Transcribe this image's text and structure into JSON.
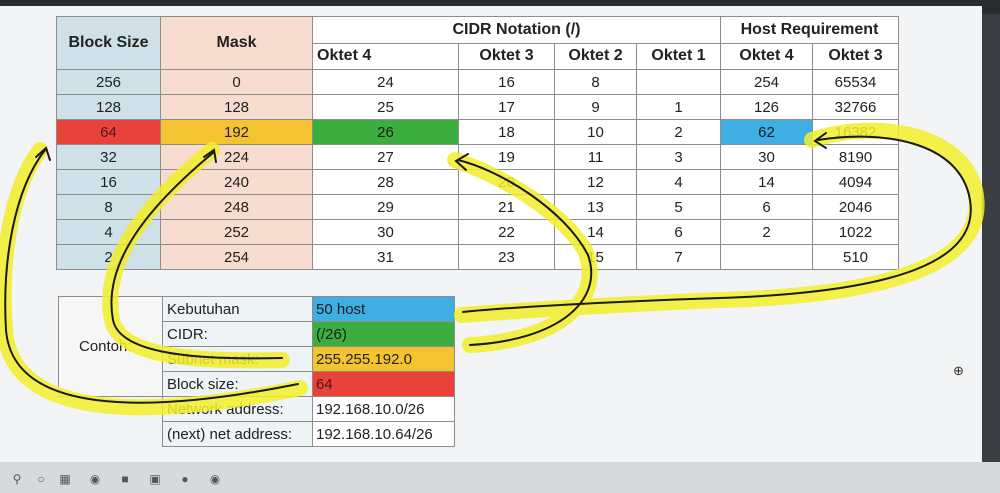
{
  "main_table": {
    "headers": {
      "block_size": "Block Size",
      "mask": "Mask",
      "cidr_group": "CIDR Notation (/)",
      "host_group": "Host Requirement",
      "oktet4": "Oktet 4",
      "oktet3": "Oktet 3",
      "oktet2": "Oktet 2",
      "oktet1": "Oktet 1",
      "host_oktet4": "Oktet 4",
      "host_oktet3": "Oktet 3"
    },
    "rows": [
      {
        "block": "256",
        "mask": "0",
        "c4": "24",
        "c3": "16",
        "c2": "8",
        "c1": "",
        "h4": "254",
        "h3": "65534"
      },
      {
        "block": "128",
        "mask": "128",
        "c4": "25",
        "c3": "17",
        "c2": "9",
        "c1": "1",
        "h4": "126",
        "h3": "32766"
      },
      {
        "block": "64",
        "mask": "192",
        "c4": "26",
        "c3": "18",
        "c2": "10",
        "c1": "2",
        "h4": "62",
        "h3": "16382"
      },
      {
        "block": "32",
        "mask": "224",
        "c4": "27",
        "c3": "19",
        "c2": "11",
        "c1": "3",
        "h4": "30",
        "h3": "8190"
      },
      {
        "block": "16",
        "mask": "240",
        "c4": "28",
        "c3": "20",
        "c2": "12",
        "c1": "4",
        "h4": "14",
        "h3": "4094"
      },
      {
        "block": "8",
        "mask": "248",
        "c4": "29",
        "c3": "21",
        "c2": "13",
        "c1": "5",
        "h4": "6",
        "h3": "2046"
      },
      {
        "block": "4",
        "mask": "252",
        "c4": "30",
        "c3": "22",
        "c2": "14",
        "c1": "6",
        "h4": "2",
        "h3": "1022"
      },
      {
        "block": "2",
        "mask": "254",
        "c4": "31",
        "c3": "23",
        "c2": "15",
        "c1": "7",
        "h4": "",
        "h3": "510"
      }
    ]
  },
  "example": {
    "title": "Contoh:",
    "rows": [
      {
        "label": "Kebutuhan",
        "value": "50 host"
      },
      {
        "label": "CIDR:",
        "value": "(/26)"
      },
      {
        "label": "Subnet mask:",
        "value": "255.255.192.0"
      },
      {
        "label": "Block size:",
        "value": "64"
      },
      {
        "label": "Network address:",
        "value": "192.168.10.0/26"
      },
      {
        "label": "(next) net address:",
        "value": "192.168.10.64/26"
      }
    ]
  },
  "highlight_colors": {
    "block": "#e8423b",
    "mask": "#f4c330",
    "cidr": "#3cae3f",
    "host": "#3eaee3",
    "marker": "#f2ee2a"
  },
  "icons": {
    "zoom": "zoom-in-icon",
    "taskbar": [
      "search-icon",
      "cortana-icon",
      "task-view-icon",
      "edge-icon",
      "file-explorer-icon",
      "store-icon",
      "app-icon",
      "chrome-icon"
    ]
  }
}
